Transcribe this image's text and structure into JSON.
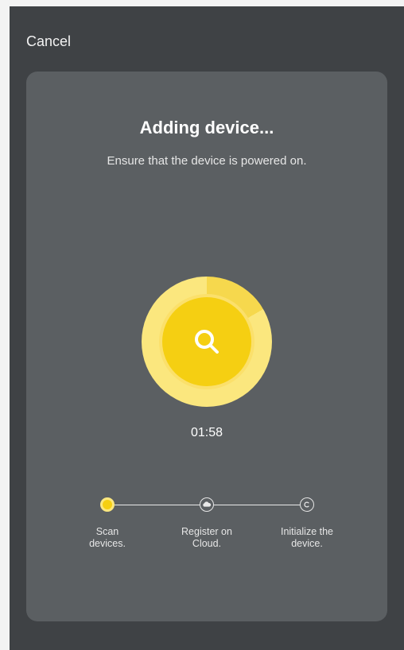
{
  "header": {
    "cancel_label": "Cancel"
  },
  "card": {
    "title": "Adding device...",
    "subtitle": "Ensure that the device is powered on.",
    "timer": "01:58"
  },
  "steps": [
    {
      "line1": "Scan",
      "line2": "devices.",
      "status": "active",
      "icon": "active-dot-icon"
    },
    {
      "line1": "Register on",
      "line2": "Cloud.",
      "status": "pending",
      "icon": "cloud-icon"
    },
    {
      "line1": "Initialize the",
      "line2": "device.",
      "status": "pending",
      "icon": "c-circle-icon"
    }
  ],
  "colors": {
    "accent": "#f5cf12",
    "accent_light": "#fbe77e",
    "background": "#3f4245",
    "card": "#5b5f62"
  }
}
